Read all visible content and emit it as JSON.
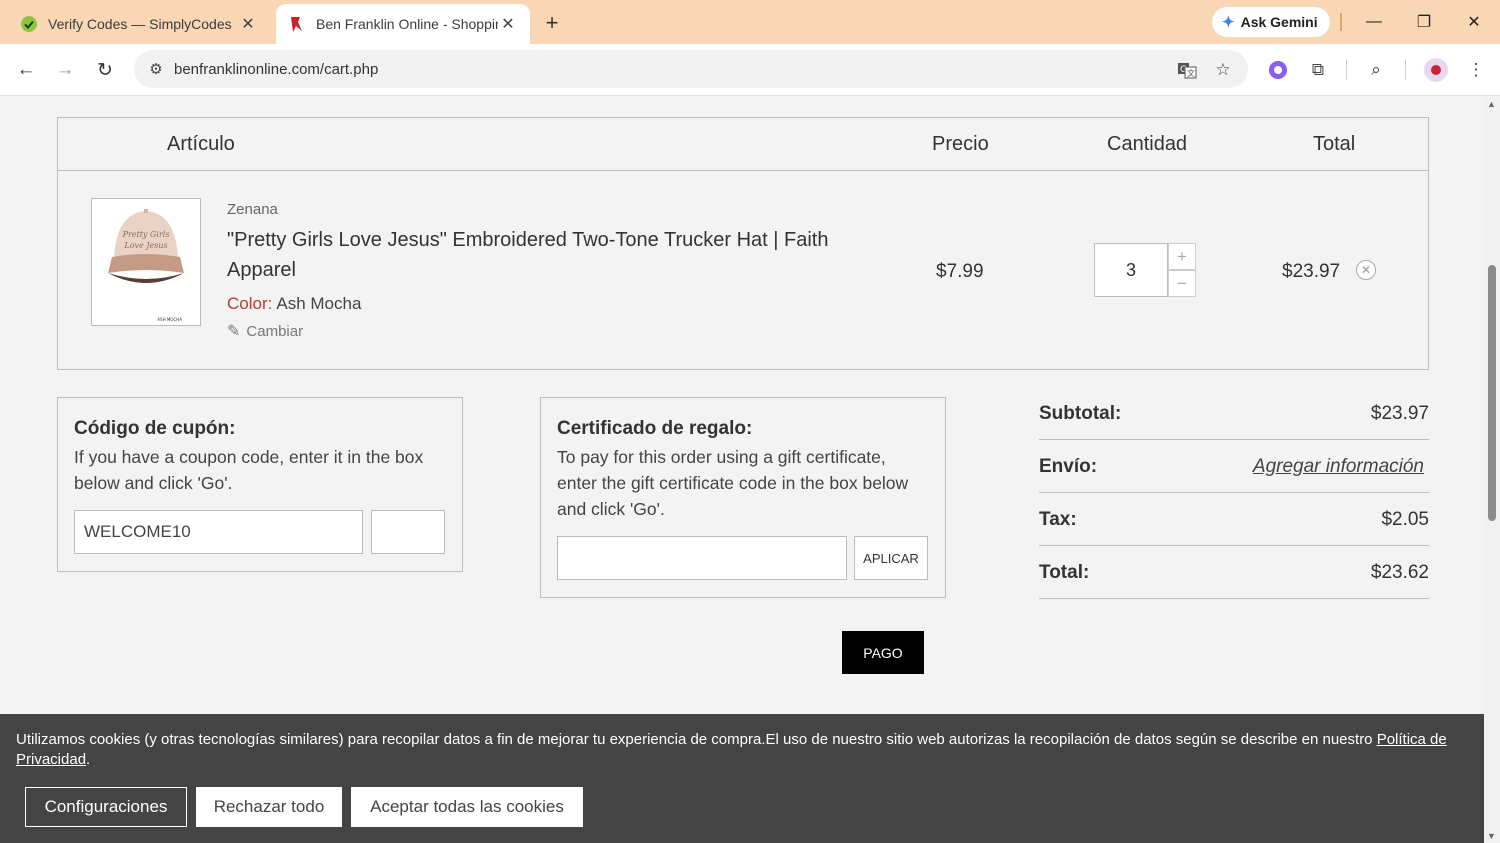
{
  "browser": {
    "tabs": [
      {
        "title": "Verify Codes — SimplyCodes",
        "active": false
      },
      {
        "title": "Ben Franklin Online - Shopping",
        "active": true
      }
    ],
    "ask_gemini_label": "Ask Gemini",
    "url": "benfranklinonline.com/cart.php"
  },
  "cart": {
    "headers": {
      "item": "Artículo",
      "price": "Precio",
      "quantity": "Cantidad",
      "total": "Total"
    },
    "item": {
      "brand": "Zenana",
      "name": "\"Pretty Girls Love Jesus\" Embroidered Two-Tone Trucker Hat | Faith Apparel",
      "color_label": "Color:",
      "color_value": "Ash Mocha",
      "change_label": "Cambiar",
      "price": "$7.99",
      "quantity": "3",
      "line_total": "$23.97",
      "image_text": {
        "line1": "Pretty Girls",
        "line2": "Love Jesus",
        "tag": "ASH MOCHA"
      }
    }
  },
  "coupon": {
    "title": "Código de cupón:",
    "description": "If you have a coupon code, enter it in the box below and click 'Go'.",
    "value": "WELCOME10",
    "go_label": ""
  },
  "gift": {
    "title": "Certificado de regalo:",
    "description": "To pay for this order using a gift certificate, enter the gift certificate code in the box below and click 'Go'.",
    "value": "",
    "apply_label": "APLICAR"
  },
  "summary": {
    "subtotal_label": "Subtotal:",
    "subtotal_value": "$23.97",
    "shipping_label": "Envío:",
    "shipping_link": "Agregar información",
    "tax_label": "Tax:",
    "tax_value": "$2.05",
    "total_label": "Total:",
    "total_value": "$23.62"
  },
  "checkout_label": "PAGO",
  "cookies": {
    "text": "Utilizamos cookies (y otras tecnologías similares) para recopilar datos a fin de mejorar tu experiencia de compra.El uso de nuestro sitio web autorizas la recopilación de datos según se describe en nuestro ",
    "link": "Política de Privacidad",
    "suffix": ".",
    "settings_label": "Configuraciones",
    "reject_label": "Rechazar todo",
    "accept_label": "Aceptar todas las cookies"
  },
  "colors": {
    "tabbar": "#f9d7b5",
    "color_label": "#c0392b",
    "cookie_banner": "#444444",
    "checkout_button": "#000000"
  },
  "icons": [
    "simplycodes-favicon",
    "benfranklin-favicon",
    "close-icon",
    "plus-icon",
    "gemini-icon",
    "minimize-icon",
    "restore-icon",
    "back-arrow-icon",
    "forward-arrow-icon",
    "reload-icon",
    "site-info-icon",
    "translate-icon",
    "star-icon",
    "extension-icon",
    "puzzle-icon",
    "tab-search-icon",
    "kebab-menu-icon",
    "edit-icon",
    "remove-icon"
  ]
}
